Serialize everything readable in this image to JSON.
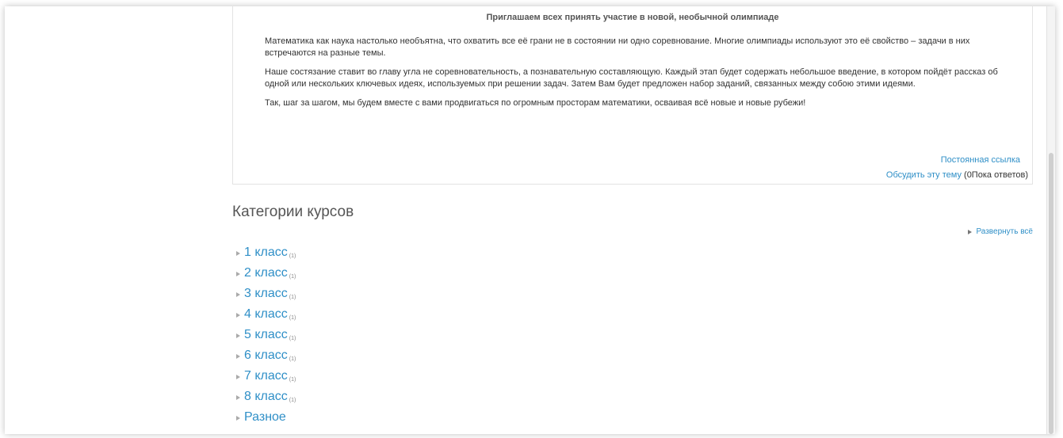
{
  "post": {
    "heading": "Приглашаем всех принять участие в новой, необычной олимпиаде",
    "paragraphs": [
      "Математика как наука настолько необъятна, что охватить все её грани не в состоянии ни одно соревнование. Многие олимпиады используют это её свойство – задачи в них встречаются на разные темы.",
      "Наше состязание ставит во главу угла не соревновательность, а познавательную  составляющую. Каждый  этап будет содержать небольшое введение, в котором пойдёт рассказ об одной или нескольких ключевых идеях, используемых при решении задач. Затем Вам будет предложен набор заданий, связанных между собою этими идеями.",
      "Так, шаг за шагом, мы будем вместе с вами продвигаться по огромным просторам математики, осваивая всё новые и новые рубежи!"
    ],
    "permalink_label": "Постоянная ссылка",
    "discuss_label": "Обсудить эту тему",
    "replies_label": "(0Пока ответов)"
  },
  "categories": {
    "heading": "Категории курсов",
    "expand_all_label": "Развернуть всё",
    "items": [
      {
        "name": "1 класс",
        "count": "(1)"
      },
      {
        "name": "2 класс",
        "count": "(1)"
      },
      {
        "name": "3 класс",
        "count": "(1)"
      },
      {
        "name": "4 класс",
        "count": "(1)"
      },
      {
        "name": "5 класс",
        "count": "(1)"
      },
      {
        "name": "6 класс",
        "count": "(1)"
      },
      {
        "name": "7 класс",
        "count": "(1)"
      },
      {
        "name": "8 класс",
        "count": "(1)"
      },
      {
        "name": "Разное",
        "count": ""
      }
    ]
  }
}
